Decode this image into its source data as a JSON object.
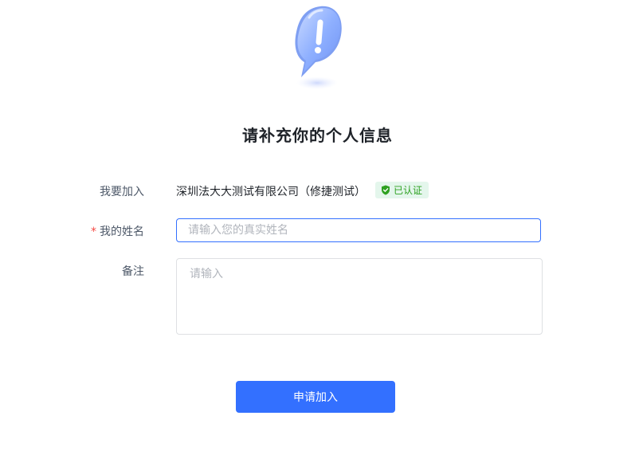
{
  "header": {
    "title": "请补充你的个人信息"
  },
  "form": {
    "join": {
      "label": "我要加入",
      "company": "深圳法大大测试有限公司（修捷测试）",
      "badge": "已认证"
    },
    "name": {
      "required_mark": "*",
      "label": "我的姓名",
      "value": "",
      "placeholder": "请输入您的真实姓名"
    },
    "remark": {
      "label": "备注",
      "value": "",
      "placeholder": "请输入"
    },
    "submit_label": "申请加入"
  },
  "icons": {
    "hero": "exclamation-bubble-icon",
    "badge": "shield-check-icon"
  },
  "colors": {
    "accent": "#3370ff",
    "required": "#f54a45",
    "badge_bg": "#e4f6ec",
    "badge_text": "#2ea121"
  }
}
